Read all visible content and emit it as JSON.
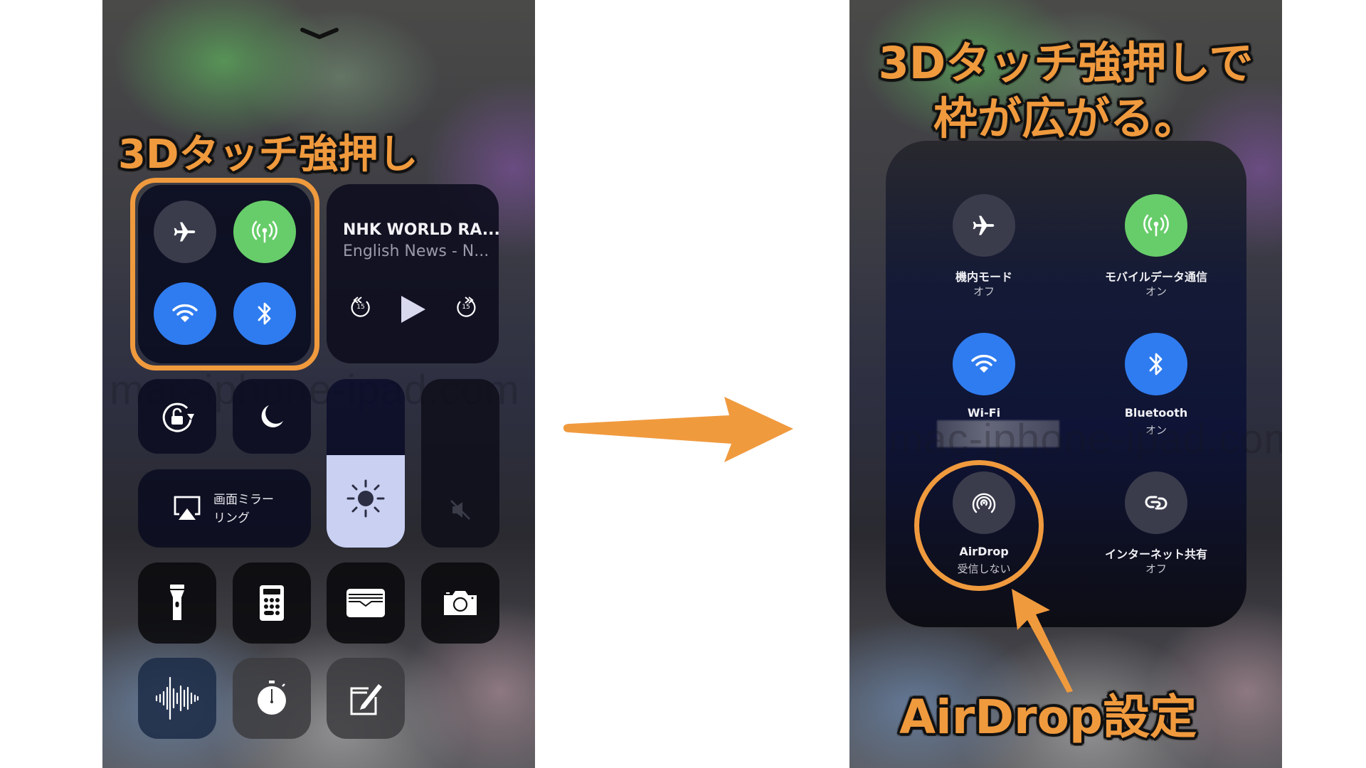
{
  "left_screen": {
    "caption": "3Dタッチ強押し",
    "dismiss_icon": "chevron-down-icon",
    "connectivity": [
      {
        "name": "airplane-mode",
        "icon": "airplane-icon",
        "state": "off",
        "color": "#3a3c4c"
      },
      {
        "name": "cellular-data",
        "icon": "antenna-icon",
        "state": "on",
        "color": "#67cd6a"
      },
      {
        "name": "wifi",
        "icon": "wifi-icon",
        "state": "on",
        "color": "#2f7cf0"
      },
      {
        "name": "bluetooth",
        "icon": "bluetooth-icon",
        "state": "on",
        "color": "#2f7cf0"
      }
    ],
    "now_playing": {
      "title": "NHK WORLD RA...",
      "subtitle": "English News - N...",
      "skip_back_seconds": "15",
      "skip_forward_seconds": "15"
    },
    "screen_mirroring": {
      "label_line1": "画面ミラー",
      "label_line2": "リング"
    },
    "brightness_level": 0.55,
    "volume_level": 0,
    "volume_muted": true,
    "shortcuts": [
      {
        "name": "orientation-lock",
        "icon": "rotation-lock-icon"
      },
      {
        "name": "do-not-disturb",
        "icon": "moon-icon"
      },
      {
        "name": "flashlight",
        "icon": "flashlight-icon"
      },
      {
        "name": "calculator",
        "icon": "calculator-icon"
      },
      {
        "name": "wallet",
        "icon": "wallet-icon"
      },
      {
        "name": "camera",
        "icon": "camera-icon"
      },
      {
        "name": "voice-memos",
        "icon": "waveform-icon"
      },
      {
        "name": "timer",
        "icon": "stopwatch-icon"
      },
      {
        "name": "notes",
        "icon": "compose-icon"
      }
    ],
    "watermark": "mac-iphone-ipad.com"
  },
  "arrow": {
    "color": "#f09a3e",
    "direction": "right"
  },
  "right_screen": {
    "caption_line1": "3Dタッチ強押しで",
    "caption_line2": "枠が広がる。",
    "expanded_panel": [
      {
        "name": "airplane-mode",
        "label": "機内モード",
        "status": "オフ",
        "icon": "airplane-icon",
        "color": "#3a3c4c"
      },
      {
        "name": "cellular-data",
        "label": "モバイルデータ通信",
        "status": "オン",
        "icon": "antenna-icon",
        "color": "#67cd6a"
      },
      {
        "name": "wifi",
        "label": "Wi-Fi",
        "status": "",
        "icon": "wifi-icon",
        "color": "#2f7cf0"
      },
      {
        "name": "bluetooth",
        "label": "Bluetooth",
        "status": "オン",
        "icon": "bluetooth-icon",
        "color": "#2f7cf0"
      },
      {
        "name": "airdrop",
        "label": "AirDrop",
        "status": "受信しない",
        "icon": "airdrop-icon",
        "color": "#3a3c4c"
      },
      {
        "name": "personal-hotspot",
        "label": "インターネット共有",
        "status": "オフ",
        "icon": "hotspot-link-icon",
        "color": "#3a3c4c"
      }
    ],
    "callout_label": "AirDrop設定",
    "watermark": "mac-iphone-ipad.com"
  },
  "accent_color": "#f09a3e"
}
